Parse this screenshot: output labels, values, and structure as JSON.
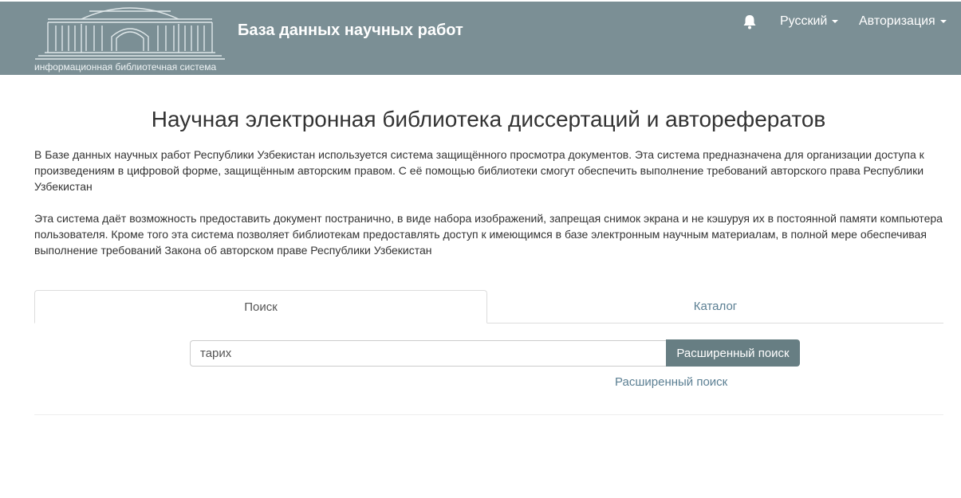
{
  "header": {
    "logo_caption": "информационная библиотечная система",
    "title": "База данных научных работ",
    "bell_icon": "bell-icon",
    "language_label": "Русский",
    "auth_label": "Авторизация",
    "bg_color": "#7b8f95"
  },
  "main": {
    "title": "Научная электронная библиотека диссертаций и авторефератов",
    "paragraph1": "В Базе данных научных работ Республики Узбекистан используется система защищённого просмотра документов. Эта система предназначена для организации доступа к произведениям в цифровой форме, защищённым авторским правом. С её помощью библиотеки смогут обеспечить выполнение требований авторского права Республики Узбекистан",
    "paragraph2": "Эта система даёт возможность предоставить документ постранично, в виде набора изображений, запрещая снимок экрана и не кэшуруя их в постоянной памяти компьютера пользователя. Кроме того эта система позволяет библиотекам предоставлять доступ к имеющимся в базе электронным научным материалам, в полной мере обеспечивая выполнение требований Закона об авторском праве Республики Узбекистан"
  },
  "tabs": [
    {
      "label": "Поиск",
      "active": true
    },
    {
      "label": "Каталог",
      "active": false
    }
  ],
  "search": {
    "value": "тарих",
    "button_label": "Расширенный поиск",
    "advanced_link": "Расширенный поиск",
    "button_color": "#677e83",
    "link_color": "#5b7f93"
  }
}
